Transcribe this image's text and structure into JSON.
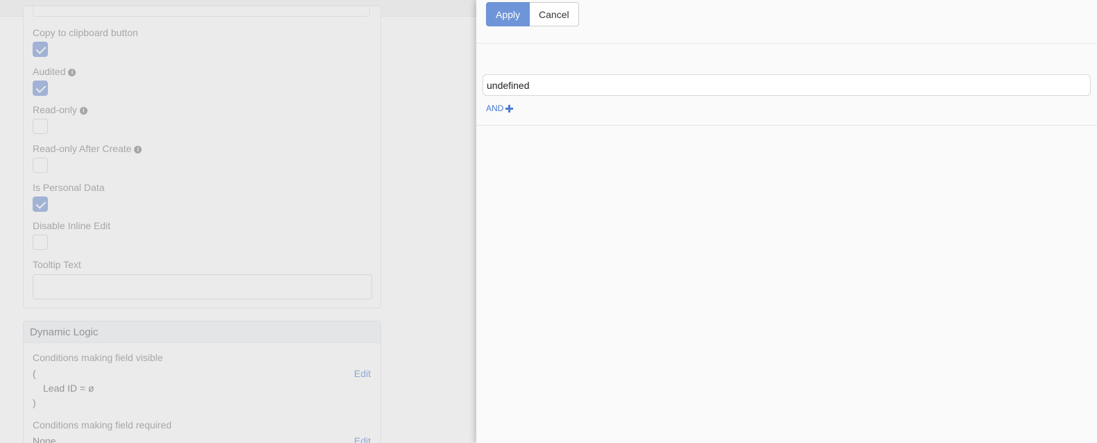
{
  "background": {
    "fields": {
      "copy_clipboard_label": "Copy to clipboard button",
      "copy_clipboard_checked": true,
      "audited_label": "Audited",
      "audited_checked": true,
      "readonly_label": "Read-only",
      "readonly_checked": false,
      "readonly_after_create_label": "Read-only After Create",
      "readonly_after_create_checked": false,
      "personal_data_label": "Is Personal Data",
      "personal_data_checked": true,
      "disable_inline_edit_label": "Disable Inline Edit",
      "disable_inline_edit_checked": false,
      "tooltip_text_label": "Tooltip Text",
      "tooltip_text_value": ""
    },
    "dynamic_logic": {
      "title": "Dynamic Logic",
      "visible_label": "Conditions making field visible",
      "visible_open": "(",
      "visible_condition": "Lead ID = ø",
      "visible_close": ")",
      "visible_edit": "Edit",
      "required_label": "Conditions making field required",
      "required_value": "None",
      "required_edit": "Edit"
    },
    "info_glyph": "i"
  },
  "modal": {
    "apply_label": "Apply",
    "cancel_label": "Cancel",
    "condition_value": "undefined",
    "and_label": "AND"
  },
  "icons": {
    "info": "info-icon",
    "check": "checkmark-icon",
    "plus": "plus-icon"
  },
  "colors": {
    "accent": "#6e95d8",
    "link": "#4a7bd0",
    "checkbox_checked": "#6e90d6"
  }
}
